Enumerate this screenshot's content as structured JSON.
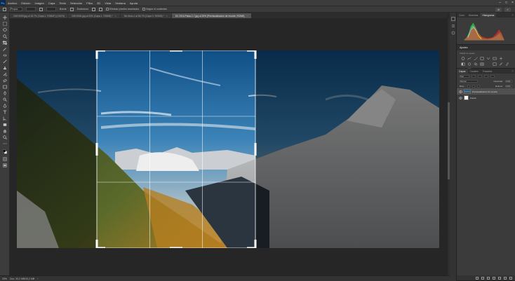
{
  "menubar": {
    "logo": "Ps",
    "items": [
      "Archivo",
      "Edición",
      "Imagen",
      "Capa",
      "Texto",
      "Selección",
      "Filtro",
      "3D",
      "Vista",
      "Ventana",
      "Ayuda"
    ],
    "controls": [
      "–",
      "□",
      "×"
    ]
  },
  "options_bar": {
    "ratio_label": "Propor.",
    "clear_label": "Borrar",
    "straighten_label": "Enderezar",
    "delete_pixels_label": "Eliminar píxeles recortados",
    "content_aware_label": "Según el contenido",
    "cancel_label": "⊘",
    "commit_label": "✓"
  },
  "tabs": [
    {
      "label": "20674059.jpg al 18,7% (Capa 1, RGB/8*) (CMYK)",
      "active": false
    },
    {
      "label": "20674061.jpg al 33% (Capa 1, RGB/8) *",
      "active": false
    },
    {
      "label": "Sin título-1 al 66,7% (Capa 0, RGB/8) *",
      "active": false
    },
    {
      "label": "DX 2016-Paisa-1-7.jpg al 33% (Previsualización de recorte, RGB/8)",
      "active": true
    }
  ],
  "tab_close": "×",
  "status": {
    "zoom": "33%",
    "doc": "Doc: 33,2 MB/33,2 MB",
    "arrow": "›"
  },
  "histogram_panel": {
    "tabs": [
      "Color",
      "Muestras",
      "Info",
      "Histograma"
    ],
    "active_tab": "Histograma",
    "menu": "≡"
  },
  "adjustments_panel": {
    "title": "Ajustes",
    "subtitle": "Añadir un ajuste"
  },
  "layers_panel": {
    "tabs": [
      "Capas",
      "Canales",
      "Trazados"
    ],
    "active_tab": "Capas",
    "kind_label": "Tipo",
    "blend_mode": "Normal",
    "opacity_label": "Opacidad:",
    "opacity_value": "100%",
    "lock_label": "Bloq.:",
    "fill_label": "Relleno:",
    "fill_value": "100%",
    "layers": [
      {
        "name": "Previsualización de recorte",
        "selected": true,
        "thumb": "photo"
      },
      {
        "name": "Fondo",
        "selected": false,
        "thumb": "white"
      }
    ]
  },
  "colors": {
    "accent": "#31a8ff",
    "ui_dark": "#282828",
    "ui_panel": "#3b3b3b",
    "ui_bar": "#3c3c3c"
  }
}
